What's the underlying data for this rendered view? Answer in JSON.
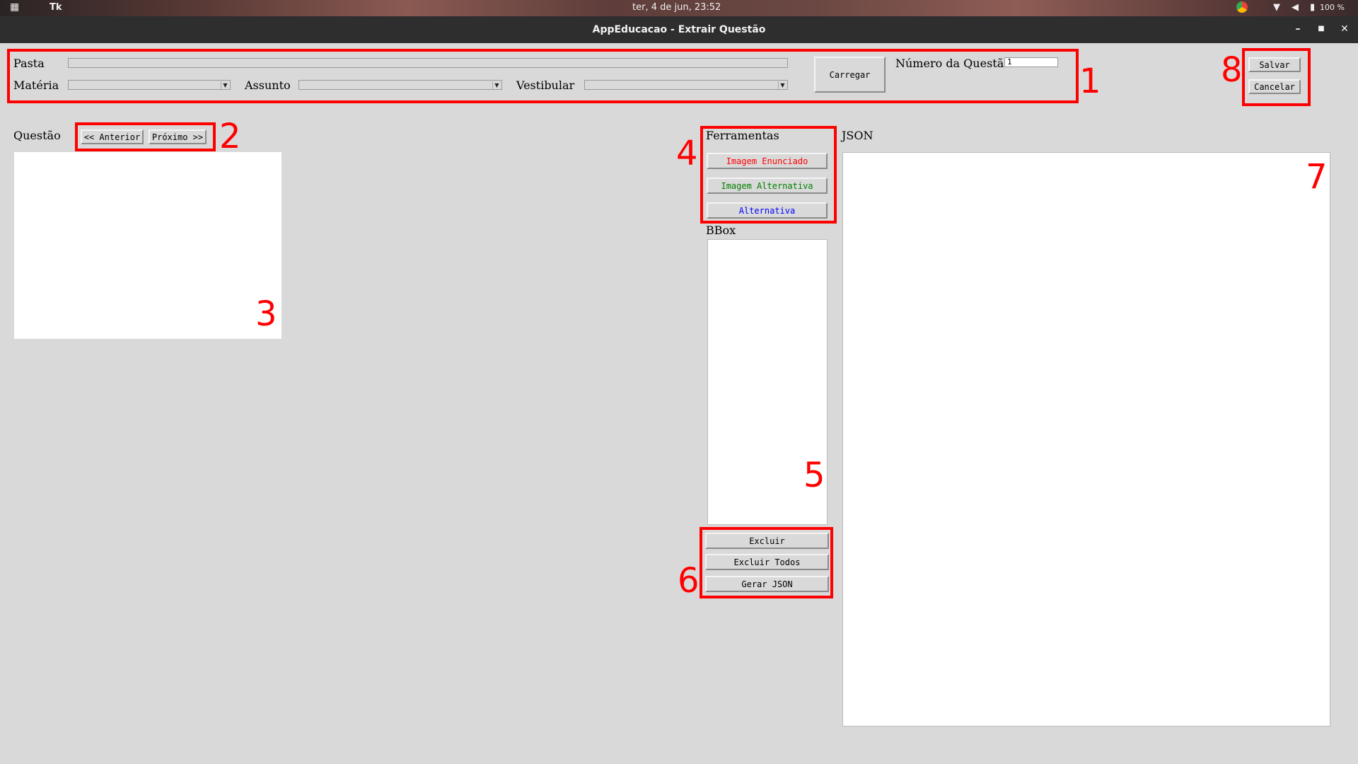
{
  "system_bar": {
    "app_name": "Tk",
    "clock": "ter,  4 de jun, 23:52",
    "battery": "100 %"
  },
  "window": {
    "title": "AppEducacao - Extrair Questão"
  },
  "top_section": {
    "pasta_label": "Pasta",
    "pasta_value": "",
    "materia_label": "Matéria",
    "assunto_label": "Assunto",
    "vestibular_label": "Vestibular",
    "carregar_label": "Carregar",
    "numero_label": "Número da Questão",
    "numero_value": "1"
  },
  "questao": {
    "label": "Questão",
    "anterior_label": "<< Anterior",
    "proximo_label": "Próximo >>"
  },
  "ferramentas": {
    "label": "Ferramentas",
    "imagem_enunciado": "Imagem Enunciado",
    "imagem_alternativa": "Imagem Alternativa",
    "alternativa": "Alternativa",
    "colors": {
      "enunciado": "#ff0000",
      "alternativa_img": "#008000",
      "alternativa": "#0000ff"
    }
  },
  "bbox": {
    "label": "BBox",
    "excluir": "Excluir",
    "excluir_todos": "Excluir Todos",
    "gerar_json": "Gerar JSON"
  },
  "json_panel": {
    "label": "JSON"
  },
  "actions": {
    "salvar": "Salvar",
    "cancelar": "Cancelar"
  },
  "annotations": [
    "1",
    "2",
    "3",
    "4",
    "5",
    "6",
    "7",
    "8"
  ]
}
